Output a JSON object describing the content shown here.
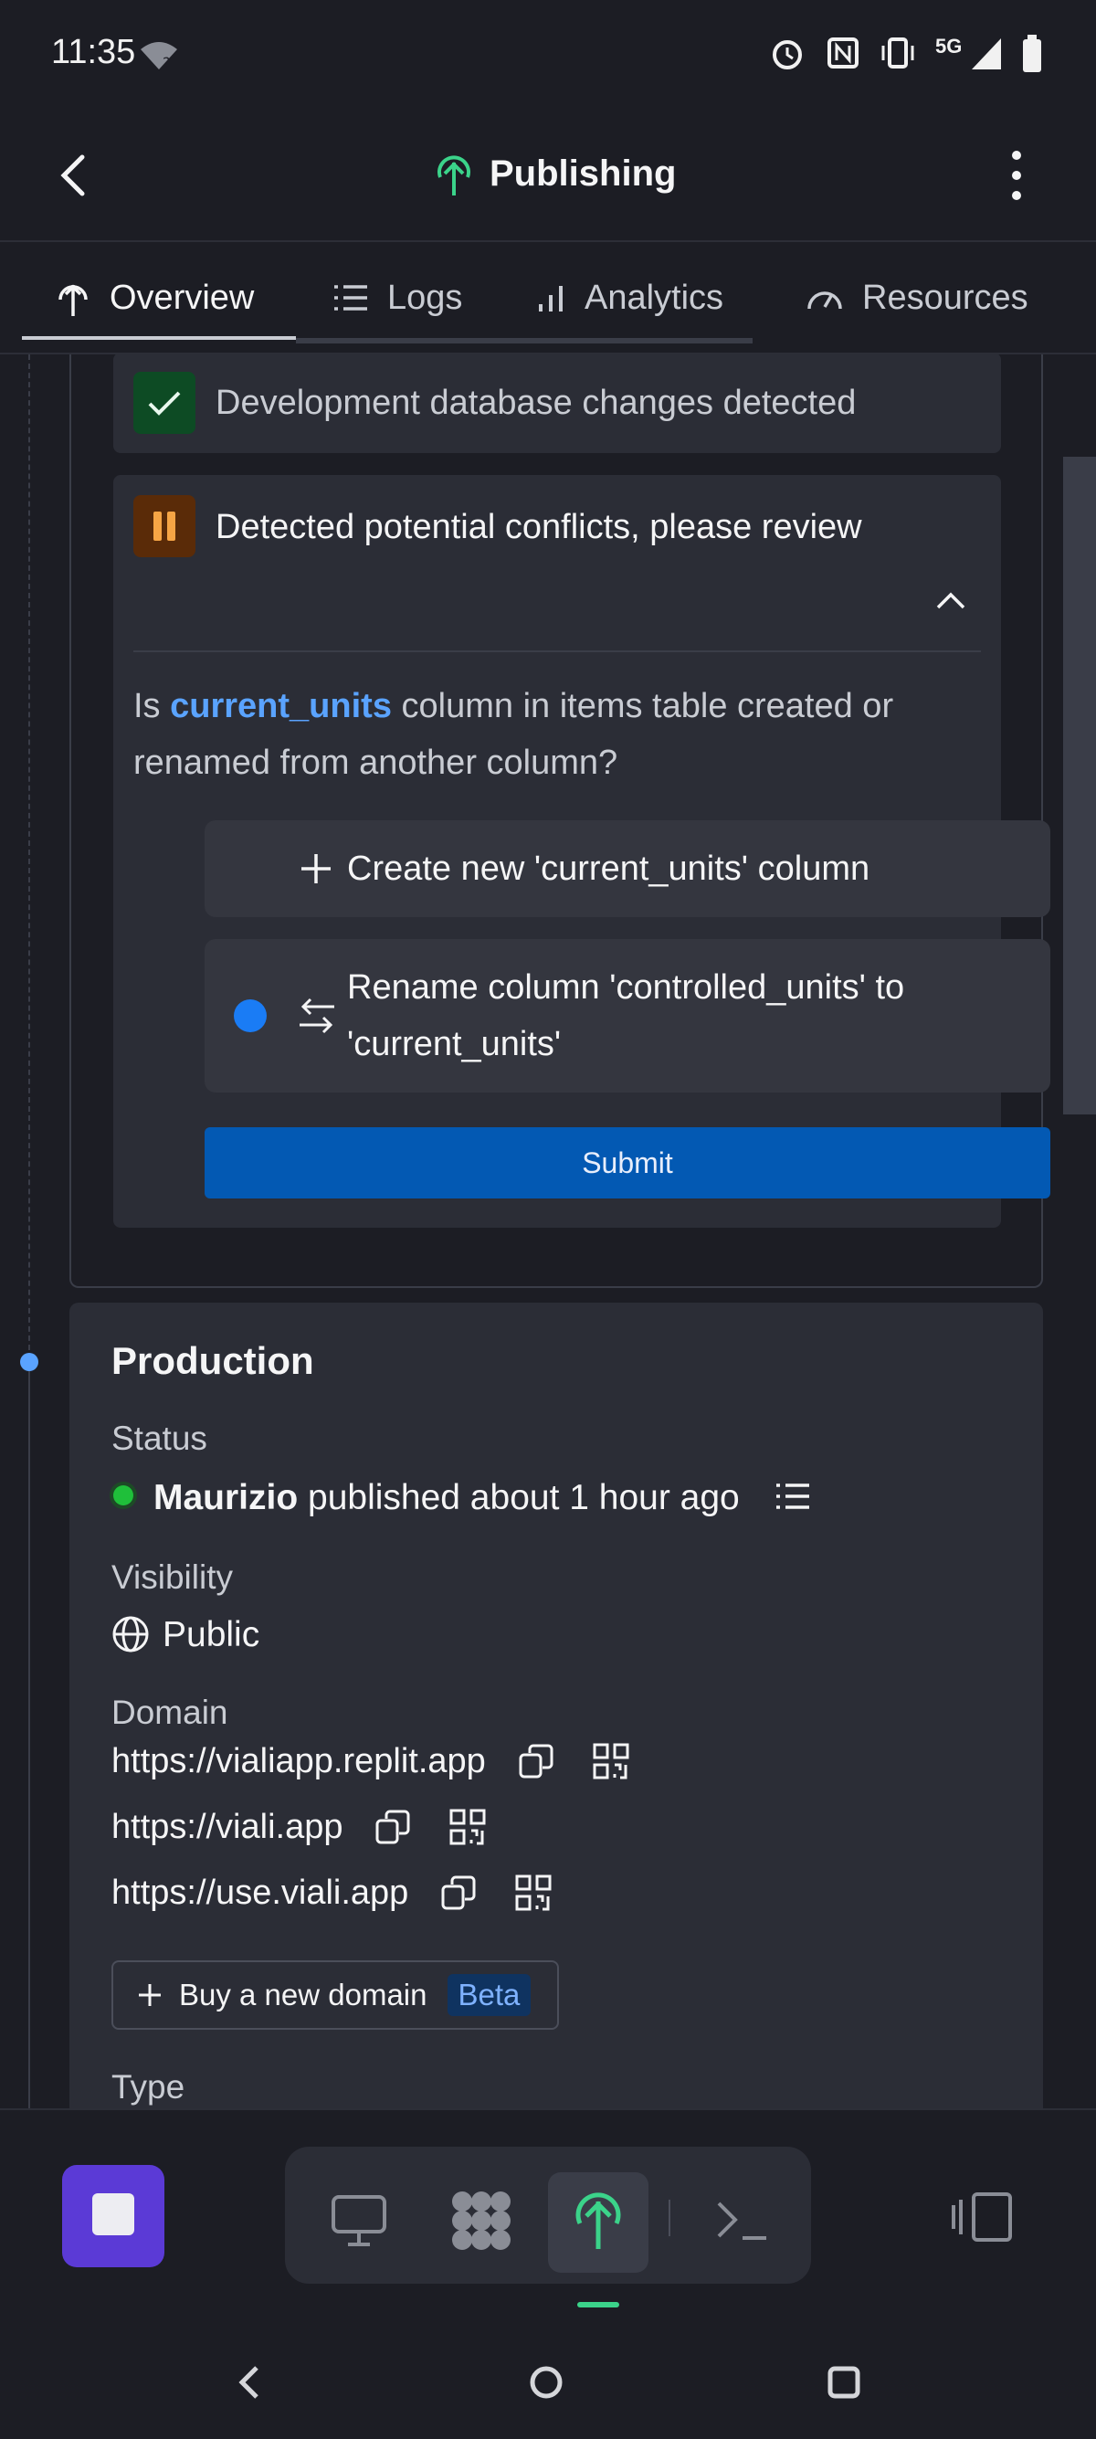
{
  "status_bar": {
    "time": "11:35",
    "network_label": "5G"
  },
  "app_bar": {
    "title": "Publishing"
  },
  "tabs": [
    {
      "label": "Overview",
      "active": true
    },
    {
      "label": "Logs",
      "active": false
    },
    {
      "label": "Analytics",
      "active": false
    },
    {
      "label": "Resources",
      "active": false
    }
  ],
  "steps": {
    "db_changes": "Development database changes detected",
    "conflicts": "Detected potential conflicts, please review"
  },
  "question": {
    "prefix": "Is ",
    "column": "current_units",
    "suffix_line1": " column in items table created or",
    "line2": "renamed from another column?"
  },
  "choices": {
    "create": "Create new 'current_units' column",
    "rename_line1": "Rename column 'controlled_units' to",
    "rename_line2": "'current_units'",
    "selected": "rename"
  },
  "submit_label": "Submit",
  "production": {
    "title": "Production",
    "status_label": "Status",
    "status_user": "Maurizio",
    "status_text": " published about 1 hour ago",
    "visibility_label": "Visibility",
    "visibility_value": "Public",
    "domain_label": "Domain",
    "domains": [
      "https://vialiapp.replit.app",
      "https://viali.app",
      "https://use.viali.app"
    ],
    "buy_domain_label": "Buy a new domain",
    "beta_label": "Beta",
    "type_label": "Type"
  },
  "colors": {
    "accent_blue": "#5aa3ff",
    "submit_blue": "#0359b3",
    "success_green": "#1fbf3a",
    "publish_green": "#3bd38a",
    "stop_purple": "#5b3ad6",
    "warning_orange": "#f6a545"
  }
}
